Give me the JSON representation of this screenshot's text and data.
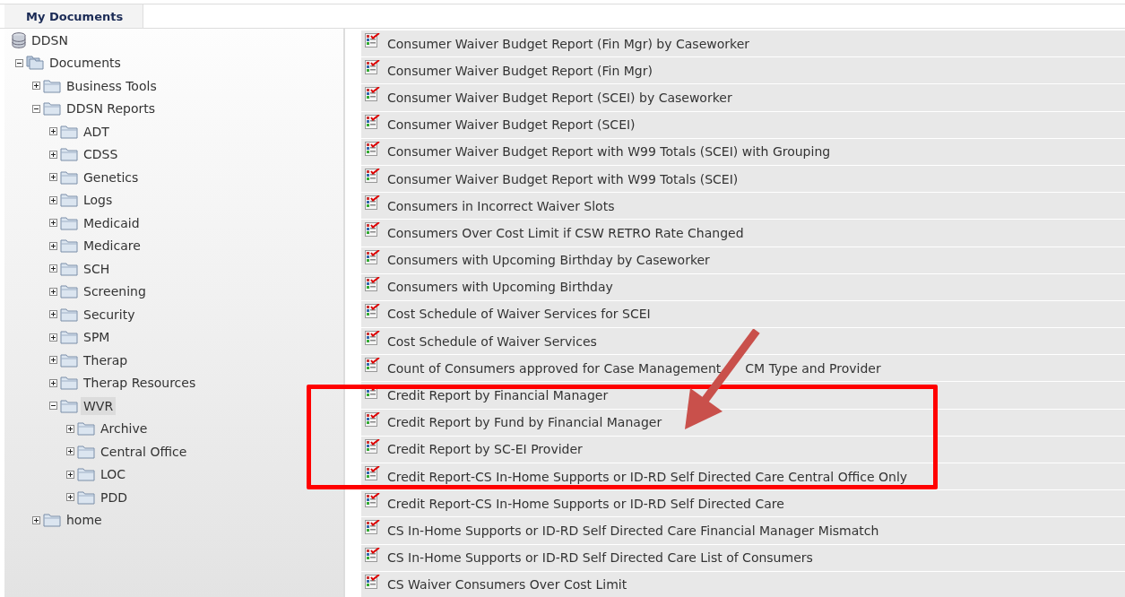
{
  "tabs": [
    {
      "label": "My Documents",
      "selected": true
    }
  ],
  "tree": [
    {
      "label": "DDSN",
      "kind": "database",
      "selected": false,
      "children": [
        {
          "label": "Documents",
          "kind": "folders",
          "expanded": true,
          "selected": false,
          "children": [
            {
              "label": "Business Tools",
              "kind": "folder",
              "expanded": false,
              "selected": false
            },
            {
              "label": "DDSN Reports",
              "kind": "folder",
              "expanded": true,
              "selected": false,
              "children": [
                {
                  "label": "ADT",
                  "kind": "folder",
                  "expanded": false,
                  "selected": false
                },
                {
                  "label": "CDSS",
                  "kind": "folder",
                  "expanded": false,
                  "selected": false
                },
                {
                  "label": "Genetics",
                  "kind": "folder",
                  "expanded": false,
                  "selected": false
                },
                {
                  "label": "Logs",
                  "kind": "folder",
                  "expanded": false,
                  "selected": false
                },
                {
                  "label": "Medicaid",
                  "kind": "folder",
                  "expanded": false,
                  "selected": false
                },
                {
                  "label": "Medicare",
                  "kind": "folder",
                  "expanded": false,
                  "selected": false
                },
                {
                  "label": "SCH",
                  "kind": "folder",
                  "expanded": false,
                  "selected": false
                },
                {
                  "label": "Screening",
                  "kind": "folder",
                  "expanded": false,
                  "selected": false
                },
                {
                  "label": "Security",
                  "kind": "folder",
                  "expanded": false,
                  "selected": false
                },
                {
                  "label": "SPM",
                  "kind": "folder",
                  "expanded": false,
                  "selected": false
                },
                {
                  "label": "Therap",
                  "kind": "folder",
                  "expanded": false,
                  "selected": false
                },
                {
                  "label": "Therap Resources",
                  "kind": "folder",
                  "expanded": false,
                  "selected": false
                },
                {
                  "label": "WVR",
                  "kind": "folder",
                  "expanded": true,
                  "selected": true,
                  "children": [
                    {
                      "label": "Archive",
                      "kind": "folder",
                      "expanded": false,
                      "selected": false
                    },
                    {
                      "label": "Central Office",
                      "kind": "folder",
                      "expanded": false,
                      "selected": false
                    },
                    {
                      "label": "LOC",
                      "kind": "folder",
                      "expanded": false,
                      "selected": false
                    },
                    {
                      "label": "PDD",
                      "kind": "folder",
                      "expanded": false,
                      "selected": false
                    }
                  ]
                }
              ]
            },
            {
              "label": "home",
              "kind": "folder",
              "expanded": false,
              "selected": false
            }
          ]
        }
      ]
    }
  ],
  "reports": [
    "Consumer Waiver Budget Report (Fin Mgr) by Caseworker",
    "Consumer Waiver Budget Report (Fin Mgr)",
    "Consumer Waiver Budget Report (SCEI) by Caseworker",
    "Consumer Waiver Budget Report (SCEI)",
    "Consumer Waiver Budget Report with W99 Totals (SCEI) with Grouping",
    "Consumer Waiver Budget Report with W99 Totals (SCEI)",
    "Consumers in Incorrect Waiver Slots",
    "Consumers Over Cost Limit if CSW RETRO Rate Changed",
    "Consumers with Upcoming Birthday by Caseworker",
    "Consumers with Upcoming Birthday",
    "Cost Schedule of Waiver Services for SCEI",
    "Cost Schedule of Waiver Services",
    [
      "Count of Consumers approved for Case Management",
      "CM Type and Provider"
    ],
    "Credit Report by Financial Manager",
    "Credit Report by Fund by Financial Manager",
    "Credit Report by SC-EI Provider",
    "Credit Report-CS In-Home Supports or ID-RD Self Directed Care Central Office Only",
    "Credit Report-CS In-Home Supports or ID-RD Self Directed Care",
    "CS In-Home Supports or ID-RD Self Directed Care Financial Manager Mismatch",
    "CS In-Home Supports or ID-RD Self Directed Care List of Consumers",
    "CS Waiver Consumers Over Cost Limit"
  ]
}
